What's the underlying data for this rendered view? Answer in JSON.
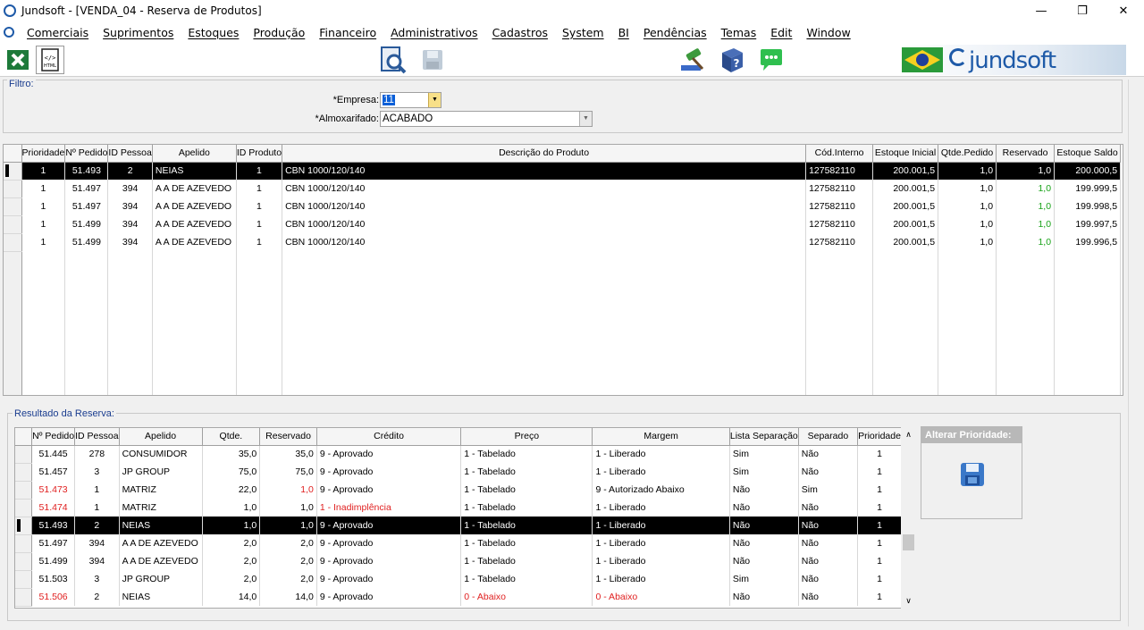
{
  "window": {
    "title": "Jundsoft - [VENDA_04 - Reserva de Produtos]"
  },
  "menu": [
    "Comerciais",
    "Suprimentos",
    "Estoques",
    "Produção",
    "Financeiro",
    "Administrativos",
    "Cadastros",
    "System",
    "BI",
    "Pendências",
    "Temas",
    "Edit",
    "Window"
  ],
  "toolbar": {
    "brand": "jundsoft"
  },
  "filter": {
    "legend": "Filtro:",
    "empresa_label": "*Empresa:",
    "empresa_value": "11",
    "almox_label": "*Almoxarifado:",
    "almox_value": "ACABADO"
  },
  "grid1": {
    "headers": [
      "Prioridade",
      "Nº Pedido",
      "ID Pessoa",
      "Apelido",
      "ID Produto",
      "Descrição do Produto",
      "Cód.Interno",
      "Estoque Inicial",
      "Qtde.Pedido",
      "Reservado",
      "Estoque Saldo"
    ],
    "rows": [
      [
        "1",
        "51.493",
        "2",
        "NEIAS",
        "1",
        "CBN 1000/120/140",
        "127582110",
        "200.001,5",
        "1,0",
        "1,0",
        "200.000,5"
      ],
      [
        "1",
        "51.497",
        "394",
        "A A DE AZEVEDO",
        "1",
        "CBN 1000/120/140",
        "127582110",
        "200.001,5",
        "1,0",
        "1,0",
        "199.999,5"
      ],
      [
        "1",
        "51.497",
        "394",
        "A A DE AZEVEDO",
        "1",
        "CBN 1000/120/140",
        "127582110",
        "200.001,5",
        "1,0",
        "1,0",
        "199.998,5"
      ],
      [
        "1",
        "51.499",
        "394",
        "A A DE AZEVEDO",
        "1",
        "CBN 1000/120/140",
        "127582110",
        "200.001,5",
        "1,0",
        "1,0",
        "199.997,5"
      ],
      [
        "1",
        "51.499",
        "394",
        "A A DE AZEVEDO",
        "1",
        "CBN 1000/120/140",
        "127582110",
        "200.001,5",
        "1,0",
        "1,0",
        "199.996,5"
      ]
    ]
  },
  "result": {
    "legend": "Resultado da Reserva:",
    "headers": [
      "Nº Pedido",
      "ID Pessoa",
      "Apelido",
      "Qtde.",
      "Reservado",
      "Crédito",
      "Preço",
      "Margem",
      "Lista Separação",
      "Separado",
      "Prioridade"
    ],
    "rows": [
      [
        "51.445",
        "278",
        "CONSUMIDOR",
        "35,0",
        "35,0",
        "9 - Aprovado",
        "1 - Tabelado",
        "1 - Liberado",
        "Sim",
        "Não",
        "1"
      ],
      [
        "51.457",
        "3",
        "JP GROUP",
        "75,0",
        "75,0",
        "9 - Aprovado",
        "1 - Tabelado",
        "1 - Liberado",
        "Sim",
        "Não",
        "1"
      ],
      [
        "51.473",
        "1",
        "MATRIZ",
        "22,0",
        "1,0",
        "9 - Aprovado",
        "1 - Tabelado",
        "9 - Autorizado Abaixo",
        "Não",
        "Sim",
        "1"
      ],
      [
        "51.474",
        "1",
        "MATRIZ",
        "1,0",
        "1,0",
        "1 - Inadimplência",
        "1 - Tabelado",
        "1 - Liberado",
        "Não",
        "Não",
        "1"
      ],
      [
        "51.493",
        "2",
        "NEIAS",
        "1,0",
        "1,0",
        "9 - Aprovado",
        "1 - Tabelado",
        "1 - Liberado",
        "Não",
        "Não",
        "1"
      ],
      [
        "51.497",
        "394",
        "A A DE AZEVEDO",
        "2,0",
        "2,0",
        "9 - Aprovado",
        "1 - Tabelado",
        "1 - Liberado",
        "Não",
        "Não",
        "1"
      ],
      [
        "51.499",
        "394",
        "A A DE AZEVEDO",
        "2,0",
        "2,0",
        "9 - Aprovado",
        "1 - Tabelado",
        "1 - Liberado",
        "Não",
        "Não",
        "1"
      ],
      [
        "51.503",
        "3",
        "JP GROUP",
        "2,0",
        "2,0",
        "9 - Aprovado",
        "1 - Tabelado",
        "1 - Liberado",
        "Sim",
        "Não",
        "1"
      ],
      [
        "51.506",
        "2",
        "NEIAS",
        "14,0",
        "14,0",
        "9 - Aprovado",
        "0 - Abaixo",
        "0 - Abaixo",
        "Não",
        "Não",
        "1"
      ]
    ]
  },
  "alter": {
    "title": "Alterar Prioridade:"
  }
}
